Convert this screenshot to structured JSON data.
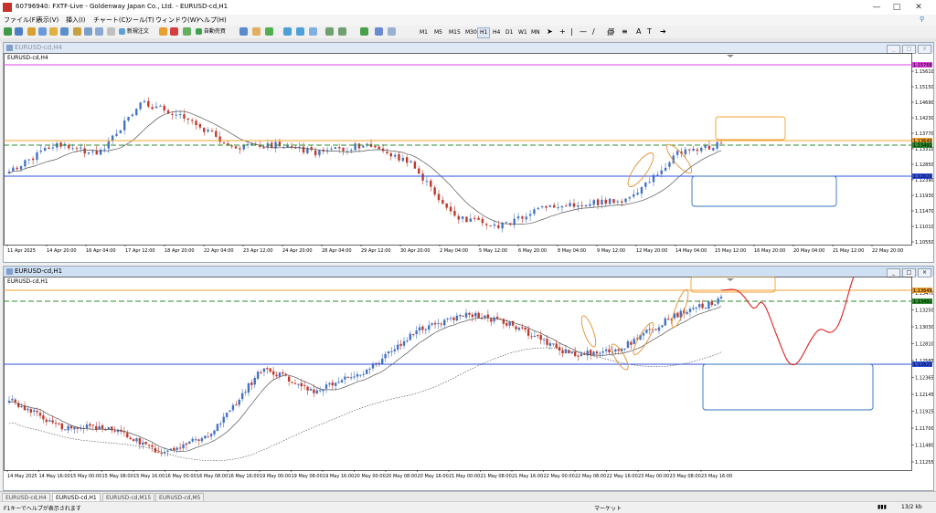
{
  "window": {
    "title": "60796940: FXTF-Live - Goldenway Japan Co., Ltd. - EURUSD-cd,H1"
  },
  "menu": [
    "ファイル(F)",
    "表示(V)",
    "挿入(I)",
    "チャート(C)",
    "ツール(T)",
    "ウィンドウ(W)",
    "ヘルプ(H)"
  ],
  "toolbar": {
    "new_order": "新規注文",
    "auto_trading": "自動売買",
    "timeframes": [
      "M1",
      "M5",
      "M15",
      "M30",
      "H1",
      "H4",
      "D1",
      "W1",
      "MN"
    ]
  },
  "chart_h4": {
    "title": "EURUSD-cd,H4",
    "symbol_label": "EURUSD-cd,H4",
    "price_ticks": [
      "1.15610",
      "1.15150",
      "1.14690",
      "1.14230",
      "1.13770",
      "1.13310",
      "1.12850",
      "1.12390",
      "1.11930",
      "1.11470",
      "1.11010",
      "1.10550"
    ],
    "marker_labels": [
      "1.15768",
      "1.13649",
      "1.13491",
      "1.12620"
    ],
    "time_labels": [
      "11 Apr 2025",
      "14 Apr 20:00",
      "16 Apr 04:00",
      "17 Apr 12:00",
      "18 Apr 20:00",
      "22 Apr 04:00",
      "23 Apr 12:00",
      "24 Apr 20:00",
      "28 Apr 04:00",
      "29 Apr 12:00",
      "30 Apr 20:00",
      "2 May 04:00",
      "5 May 12:00",
      "6 May 20:00",
      "8 May 04:00",
      "9 May 12:00",
      "12 May 20:00",
      "14 May 04:00",
      "15 May 12:00",
      "16 May 20:00",
      "20 May 04:00",
      "21 May 12:00",
      "22 May 20:00"
    ]
  },
  "chart_h1": {
    "title": "EURUSD-cd,H1",
    "symbol_label": "EURUSD-cd,H1",
    "price_ticks": [
      "1.13470",
      "1.13250",
      "1.13030",
      "1.12810",
      "1.12585",
      "1.12365",
      "1.12145",
      "1.11925",
      "1.11700",
      "1.11480",
      "1.11255"
    ],
    "marker_labels": [
      "1.13649",
      "1.13491",
      "1.12620"
    ],
    "time_labels": [
      "14 May 2025",
      "14 May 16:00",
      "15 May 00:00",
      "15 May 08:00",
      "15 May 16:00",
      "16 May 00:00",
      "16 May 08:00",
      "16 May 16:00",
      "19 May 00:00",
      "19 May 08:00",
      "19 May 16:00",
      "20 May 00:00",
      "20 May 08:00",
      "20 May 16:00",
      "21 May 00:00",
      "21 May 08:00",
      "21 May 16:00",
      "22 May 00:00",
      "22 May 08:00",
      "22 May 16:00",
      "23 May 00:00",
      "23 May 08:00",
      "23 May 16:00"
    ]
  },
  "tabs": [
    "EURUSD-cd,H4",
    "EURUSD-cd,H1",
    "EURUSD-cd,M15",
    "EURUSD-cd,M5"
  ],
  "active_tab": "EURUSD-cd,H1",
  "status": {
    "help": "F1キーでヘルプが表示されます",
    "profile": "マーケット",
    "traffic": "13/2 kb"
  },
  "colors": {
    "bull": "#4472c4",
    "bear": "#c0392b",
    "resistance": "#f0a030",
    "support": "#3050e0",
    "midline": "#2e8b2e",
    "magenta": "#e040e0",
    "forecast": "#e02020"
  }
}
